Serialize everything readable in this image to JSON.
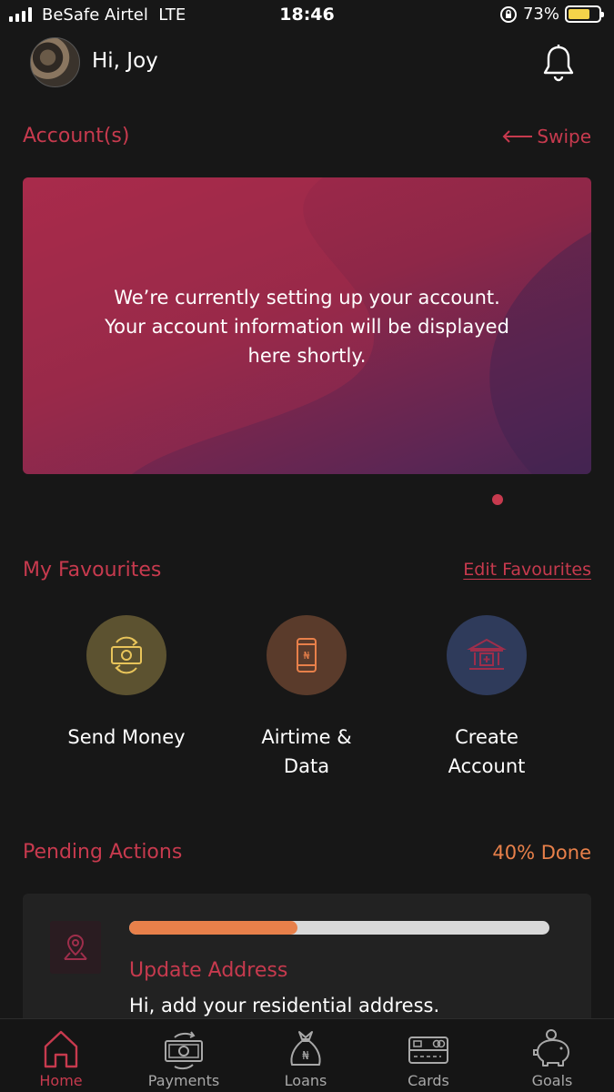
{
  "status_bar": {
    "carrier": "BeSafe Airtel  LTE",
    "time": "18:46",
    "battery": "73%",
    "battery_level": 0.73
  },
  "header": {
    "greeting": "Hi, Joy"
  },
  "accounts": {
    "title": "Account(s)",
    "swipe_label": "Swipe",
    "message": "We’re currently setting up your account. Your account information will be displayed here shortly."
  },
  "favourites": {
    "title": "My Favourites",
    "edit_label": "Edit Favourites",
    "items": [
      {
        "label": "Send Money",
        "icon": "money-transfer-icon",
        "color": "#5c5230"
      },
      {
        "label": "Airtime & Data",
        "icon": "phone-naira-icon",
        "color": "#5a3b2b"
      },
      {
        "label": "Create Account",
        "icon": "bank-icon",
        "color": "#2f3b5b"
      }
    ]
  },
  "pending": {
    "title": "Pending Actions",
    "progress_label": "40% Done",
    "progress": 0.4,
    "item_title": "Update Address",
    "item_desc": "Hi, add your residential address."
  },
  "nav": {
    "items": [
      {
        "label": "Home",
        "icon": "home-icon",
        "active": true
      },
      {
        "label": "Payments",
        "icon": "payments-icon",
        "active": false
      },
      {
        "label": "Loans",
        "icon": "loan-bag-icon",
        "active": false
      },
      {
        "label": "Cards",
        "icon": "card-icon",
        "active": false
      },
      {
        "label": "Goals",
        "icon": "piggy-bank-icon",
        "active": false
      }
    ]
  },
  "colors": {
    "accent": "#c73a4e",
    "orange": "#e8804a",
    "background": "#171717"
  }
}
